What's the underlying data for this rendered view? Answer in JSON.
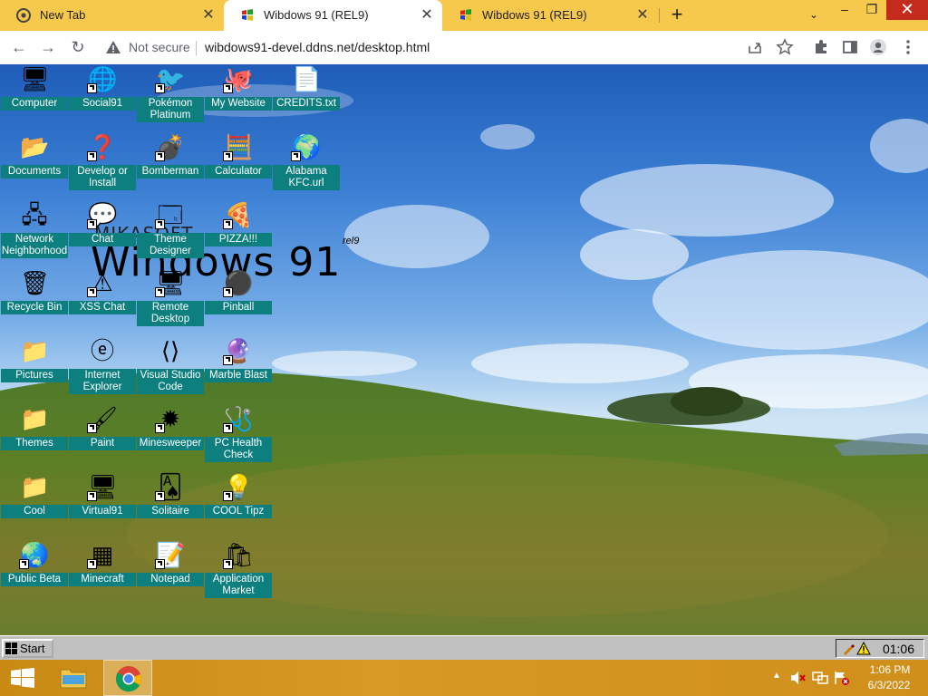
{
  "browser": {
    "tabs": [
      {
        "title": "New Tab",
        "active": false
      },
      {
        "title": "Wibdows 91 (REL9)",
        "active": true
      },
      {
        "title": "Wibdows 91 (REL9)",
        "active": false
      }
    ],
    "new_tab": "+",
    "minimize": "–",
    "maximize": "❐",
    "close": "✕",
    "tab_search": "⌄",
    "back": "←",
    "forward": "→",
    "reload": "↻",
    "security_label": "Not secure",
    "url": "wibdows91-devel.ddns.net/desktop.html"
  },
  "logo": {
    "brand": "MIKASOFT",
    "product": "Windows 91",
    "release": "rel9"
  },
  "desktop_icons": [
    {
      "label": "Computer",
      "icon": "computer-icon",
      "shortcut": false
    },
    {
      "label": "Social91",
      "icon": "globe-icon",
      "shortcut": true
    },
    {
      "label": "Pokémon Platinum",
      "icon": "pokemon-icon",
      "shortcut": true
    },
    {
      "label": "My Website",
      "icon": "github-icon",
      "shortcut": true
    },
    {
      "label": "CREDITS.txt",
      "icon": "text-file-icon",
      "shortcut": false
    },
    {
      "label": "Documents",
      "icon": "documents-folder-icon",
      "shortcut": false
    },
    {
      "label": "Develop or Install",
      "icon": "help-icon",
      "shortcut": true
    },
    {
      "label": "Bomberman",
      "icon": "bomberman-icon",
      "shortcut": true
    },
    {
      "label": "Calculator",
      "icon": "calculator-icon",
      "shortcut": true
    },
    {
      "label": "Alabama KFC.url",
      "icon": "ie-shortcut-icon",
      "shortcut": true
    },
    {
      "label": "Network Neighborhood",
      "icon": "network-icon",
      "shortcut": false
    },
    {
      "label": "Chat",
      "icon": "chat-icon",
      "shortcut": true
    },
    {
      "label": "Theme Designer",
      "icon": "window-icon",
      "shortcut": true
    },
    {
      "label": "PIZZA!!!",
      "icon": "pizza-icon",
      "shortcut": true
    },
    {
      "label": "Recycle Bin",
      "icon": "recycle-bin-icon",
      "shortcut": false
    },
    {
      "label": "XSS Chat",
      "icon": "warning-chat-icon",
      "shortcut": true
    },
    {
      "label": "Remote Desktop",
      "icon": "remote-desktop-icon",
      "shortcut": true
    },
    {
      "label": "Pinball",
      "icon": "pinball-icon",
      "shortcut": true
    },
    {
      "label": "Pictures",
      "icon": "folder-icon",
      "shortcut": false
    },
    {
      "label": "Internet Explorer",
      "icon": "internet-explorer-icon",
      "shortcut": false
    },
    {
      "label": "Visual Studio Code",
      "icon": "vscode-icon",
      "shortcut": false
    },
    {
      "label": "Marble Blast",
      "icon": "marble-icon",
      "shortcut": true
    },
    {
      "label": "Themes",
      "icon": "folder-icon",
      "shortcut": false
    },
    {
      "label": "Paint",
      "icon": "paint-icon",
      "shortcut": true
    },
    {
      "label": "Minesweeper",
      "icon": "mine-icon",
      "shortcut": true
    },
    {
      "label": "PC Health Check",
      "icon": "health-check-icon",
      "shortcut": true
    },
    {
      "label": "Cool",
      "icon": "folder-icon",
      "shortcut": false
    },
    {
      "label": "Virtual91",
      "icon": "computer-icon",
      "shortcut": true
    },
    {
      "label": "Solitaire",
      "icon": "cards-icon",
      "shortcut": true
    },
    {
      "label": "COOL Tipz",
      "icon": "tips-icon",
      "shortcut": true
    },
    {
      "label": "Public Beta",
      "icon": "beta-globe-icon",
      "shortcut": true
    },
    {
      "label": "Minecraft",
      "icon": "minecraft-icon",
      "shortcut": true
    },
    {
      "label": "Notepad",
      "icon": "notepad-icon",
      "shortcut": true
    },
    {
      "label": "Application Market",
      "icon": "market-icon",
      "shortcut": true
    }
  ],
  "w91_taskbar": {
    "start_label": "Start",
    "clock": "01:06"
  },
  "host_taskbar": {
    "time": "1:06 PM",
    "date": "6/3/2022"
  },
  "colors": {
    "tabstrip": "#f6c84c",
    "icon_label_bg": "#0d7f7f",
    "host_taskbar": "#d79a24"
  }
}
